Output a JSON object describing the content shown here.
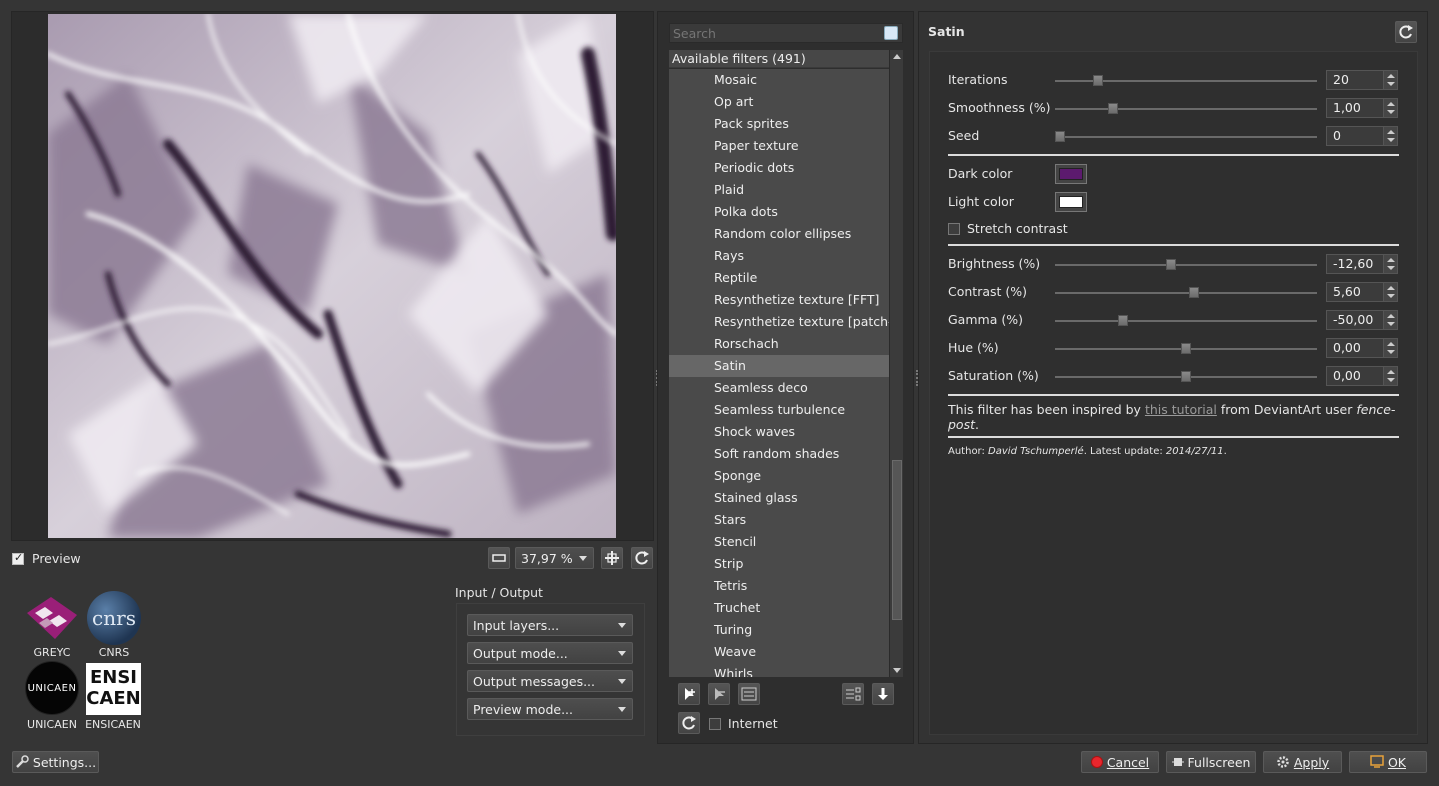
{
  "preview": {
    "checkbox_label": "Preview",
    "checked": true,
    "zoom_value": "37,97 %"
  },
  "logos": [
    {
      "label": "GREYC"
    },
    {
      "label": "CNRS",
      "mark": "cnrs"
    },
    {
      "label": "UNICAEN",
      "mark": "UNICAEN"
    },
    {
      "label": "ENSICAEN",
      "mark_top": "ENSI",
      "mark_bottom": "CAEN"
    }
  ],
  "io": {
    "title": "Input / Output",
    "input_layers": "Input layers...",
    "output_mode": "Output mode...",
    "output_messages": "Output messages...",
    "preview_mode": "Preview mode..."
  },
  "settings_label": "Settings...",
  "filters": {
    "search_placeholder": "Search",
    "header": "Available filters (491)",
    "items": [
      "Mosaic",
      "Op art",
      "Pack sprites",
      "Paper texture",
      "Periodic dots",
      "Plaid",
      "Polka dots",
      "Random color ellipses",
      "Rays",
      "Reptile",
      "Resynthetize texture [FFT]",
      "Resynthetize texture [patch-b",
      "Rorschach",
      "Satin",
      "Seamless deco",
      "Seamless turbulence",
      "Shock waves",
      "Soft random shades",
      "Sponge",
      "Stained glass",
      "Stars",
      "Stencil",
      "Strip",
      "Tetris",
      "Truchet",
      "Turing",
      "Weave",
      "Whirls"
    ],
    "selected": "Satin",
    "internet_label": "Internet",
    "internet_checked": false
  },
  "params": {
    "title": "Satin",
    "sliders_top": [
      {
        "label": "Iterations",
        "value": "20",
        "fraction": 0.15
      },
      {
        "label": "Smoothness (%)",
        "value": "1,00",
        "fraction": 0.21
      },
      {
        "label": "Seed",
        "value": "0",
        "fraction": 0.0
      }
    ],
    "dark_color_label": "Dark color",
    "dark_color": "#5c1a6e",
    "light_color_label": "Light color",
    "light_color": "#ffffff",
    "stretch_contrast_label": "Stretch contrast",
    "stretch_contrast_checked": false,
    "sliders_bottom": [
      {
        "label": "Brightness (%)",
        "value": "-12,60",
        "fraction": 0.44
      },
      {
        "label": "Contrast (%)",
        "value": "5,60",
        "fraction": 0.53
      },
      {
        "label": "Gamma (%)",
        "value": "-50,00",
        "fraction": 0.25
      },
      {
        "label": "Hue (%)",
        "value": "0,00",
        "fraction": 0.5
      },
      {
        "label": "Saturation (%)",
        "value": "0,00",
        "fraction": 0.5
      }
    ],
    "note_prefix": "This filter has been inspired by ",
    "note_link": "this tutorial",
    "note_middle": " from DeviantArt user ",
    "note_user": "fence-post",
    "note_end": ".",
    "author_prefix": "Author: ",
    "author_name": "David Tschumperlé",
    "update_prefix": ". Latest update: ",
    "update_date": "2014/27/11",
    "update_end": "."
  },
  "bottom_buttons": {
    "cancel": "Cancel",
    "fullscreen": "Fullscreen",
    "apply": "Apply",
    "ok": "OK"
  },
  "colors": {
    "accent_red": "#e8262d",
    "link": "#9a9a9a"
  }
}
